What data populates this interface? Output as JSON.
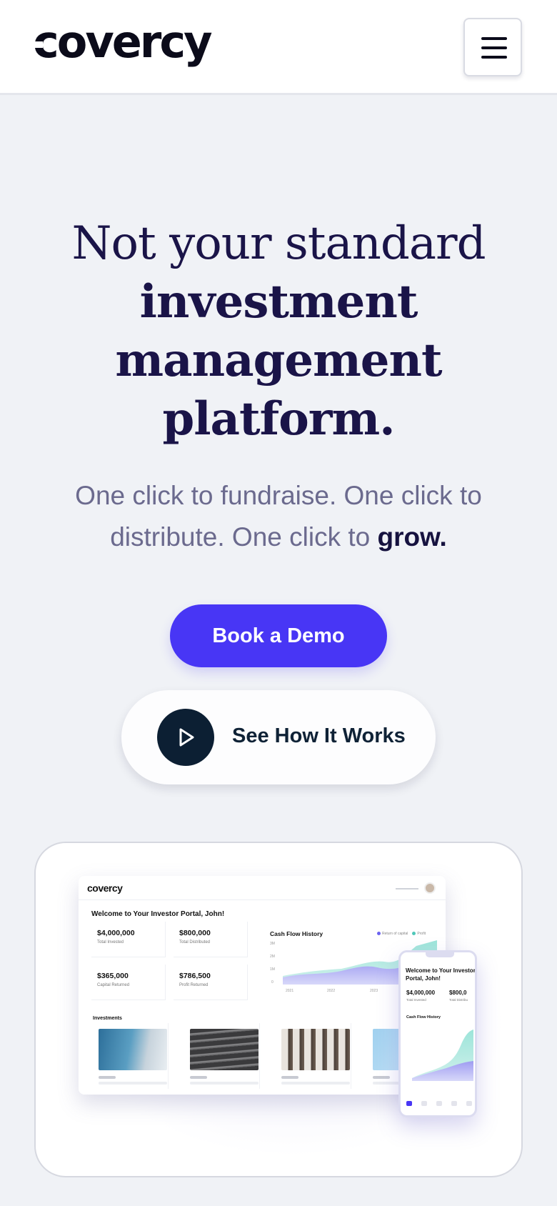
{
  "header": {
    "logo_text": "covercy",
    "menu_icon": "hamburger-menu-icon"
  },
  "hero": {
    "title_line1": "Not your standard",
    "title_line2": "investment",
    "title_line3": "management",
    "title_line4": "platform.",
    "subtitle_line1": "One click to fundraise. One click to",
    "subtitle_line2_prefix": "distribute. One click to ",
    "subtitle_line2_emphasis": "grow."
  },
  "buttons": {
    "book_demo": "Book a Demo",
    "see_how": "See How It Works",
    "play_icon": "play-icon"
  },
  "preview": {
    "desktop": {
      "logo": "covercy",
      "welcome": "Welcome to Your Investor Portal, John!",
      "stats": [
        {
          "value": "$4,000,000",
          "label": "Total Invested"
        },
        {
          "value": "$800,000",
          "label": "Total Distributed"
        },
        {
          "value": "$365,000",
          "label": "Capital Returned"
        },
        {
          "value": "$786,500",
          "label": "Profit Returned"
        }
      ],
      "cash_flow_title": "Cash Flow History",
      "legend": [
        "Return of capital",
        "Profit"
      ],
      "y_ticks": [
        "3M",
        "2M",
        "1M",
        "0"
      ],
      "x_ticks": [
        "2021",
        "2022",
        "2023"
      ],
      "investments_title": "Investments"
    },
    "phone": {
      "welcome": "Welcome to Your Investor Portal, John!",
      "stats": [
        {
          "value": "$4,000,000",
          "label": "Total Invested"
        },
        {
          "value": "$800,0",
          "label": "Total Distribu"
        }
      ],
      "cash_flow_title": "Cash Flow History"
    }
  },
  "colors": {
    "primary": "#4836f5",
    "heading": "#1a1448",
    "play_bg": "#0c1f33",
    "page_bg": "#f0f2f6"
  }
}
